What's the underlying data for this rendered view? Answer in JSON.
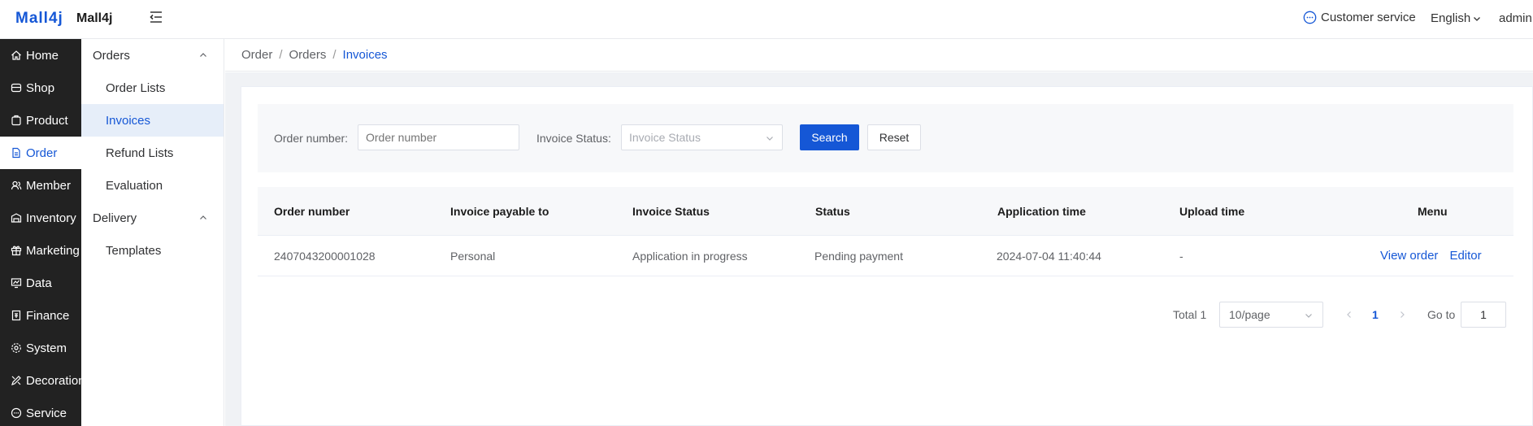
{
  "header": {
    "logo": "Mall4j",
    "app_name": "Mall4j",
    "customer_service": "Customer service",
    "language": "English",
    "user": "admin"
  },
  "sidebar": {
    "items": [
      {
        "label": "Home",
        "icon": "home-icon"
      },
      {
        "label": "Shop",
        "icon": "shop-icon"
      },
      {
        "label": "Product",
        "icon": "product-icon"
      },
      {
        "label": "Order",
        "icon": "order-icon",
        "active": true
      },
      {
        "label": "Member",
        "icon": "member-icon"
      },
      {
        "label": "Inventory",
        "icon": "inventory-icon"
      },
      {
        "label": "Marketing",
        "icon": "marketing-icon"
      },
      {
        "label": "Data",
        "icon": "data-icon"
      },
      {
        "label": "Finance",
        "icon": "finance-icon"
      },
      {
        "label": "System",
        "icon": "system-icon"
      },
      {
        "label": "Decoration",
        "icon": "decoration-icon"
      },
      {
        "label": "Service",
        "icon": "service-icon"
      }
    ]
  },
  "subnav": {
    "group1": "Orders",
    "items1": [
      "Order Lists",
      "Invoices",
      "Refund Lists",
      "Evaluation"
    ],
    "group2": "Delivery",
    "items2": [
      "Templates"
    ]
  },
  "breadcrumb": [
    "Order",
    "Orders",
    "Invoices"
  ],
  "search": {
    "order_label": "Order number:",
    "order_placeholder": "Order number",
    "status_label": "Invoice Status:",
    "status_placeholder": "Invoice Status",
    "search_button": "Search",
    "reset_button": "Reset"
  },
  "table": {
    "headers": [
      "Order number",
      "Invoice payable to",
      "Invoice Status",
      "Status",
      "Application time",
      "Upload time",
      "Menu"
    ],
    "rows": [
      {
        "order_number": "2407043200001028",
        "payable_to": "Personal",
        "invoice_status": "Application in progress",
        "status": "Pending payment",
        "application_time": "2024-07-04 11:40:44",
        "upload_time": "-",
        "actions": [
          "View order",
          "Editor"
        ]
      }
    ]
  },
  "pagination": {
    "total": "Total 1",
    "page_size": "10/page",
    "current_page": "1",
    "goto_label": "Go to",
    "goto_value": "1"
  },
  "colors": {
    "accent": "#1557d6",
    "sidebar_bg": "#222222",
    "active_sub_bg": "#e6eef9"
  }
}
